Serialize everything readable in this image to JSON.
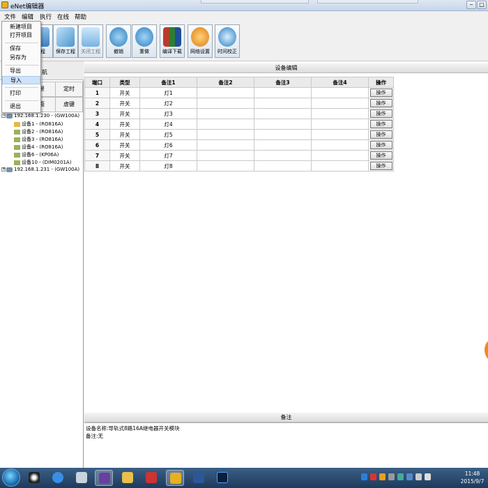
{
  "window": {
    "title": "eNet编辑器"
  },
  "menubar": [
    "文件",
    "编辑",
    "执行",
    "在线",
    "帮助"
  ],
  "file_menu": {
    "items": [
      "新建项目",
      "打开项目",
      "保存",
      "另存为",
      "导出",
      "导入",
      "打印",
      "退出"
    ],
    "highlighted": "导入"
  },
  "toolbar": {
    "buttons": [
      "工程",
      "保存工程",
      "关闭工程",
      "撤销",
      "重做",
      "编译下载",
      "网络设置",
      "时间校正"
    ]
  },
  "nav": {
    "header": "航",
    "tabs": [
      "景",
      "定时",
      "面",
      "虚键"
    ]
  },
  "tree": [
    "192.168.1.230 - (GW100A)",
    "设备1 - (RO816A)",
    "设备2 - (RO816A)",
    "设备3 - (RO816A)",
    "设备4 - (RO816A)",
    "设备6 - (KP06A)",
    "设备10 - (DIM0201A)",
    "192.168.1.231 - (GW100A)"
  ],
  "device_edit": {
    "header": "设备编辑",
    "columns": [
      "端口",
      "类型",
      "备注1",
      "备注2",
      "备注3",
      "备注4",
      "操作"
    ],
    "rows": [
      [
        "1",
        "开关",
        "灯1",
        "",
        "",
        "",
        "操作"
      ],
      [
        "2",
        "开关",
        "灯2",
        "",
        "",
        "",
        "操作"
      ],
      [
        "3",
        "开关",
        "灯3",
        "",
        "",
        "",
        "操作"
      ],
      [
        "4",
        "开关",
        "灯4",
        "",
        "",
        "",
        "操作"
      ],
      [
        "5",
        "开关",
        "灯5",
        "",
        "",
        "",
        "操作"
      ],
      [
        "6",
        "开关",
        "灯6",
        "",
        "",
        "",
        "操作"
      ],
      [
        "7",
        "开关",
        "灯7",
        "",
        "",
        "",
        "操作"
      ],
      [
        "8",
        "开关",
        "灯8",
        "",
        "",
        "",
        "操作"
      ]
    ]
  },
  "notes": {
    "header": "备注",
    "line1": "设备名称:导轨式8路16A继电器开关模块",
    "line2": "备注:无"
  },
  "taskbar": {
    "time": "11:48",
    "date": "2015/9/7"
  },
  "colors": {
    "accent": "#cfe2f8",
    "taskbar": "#1e3a5c",
    "orange": "#f08a20"
  }
}
